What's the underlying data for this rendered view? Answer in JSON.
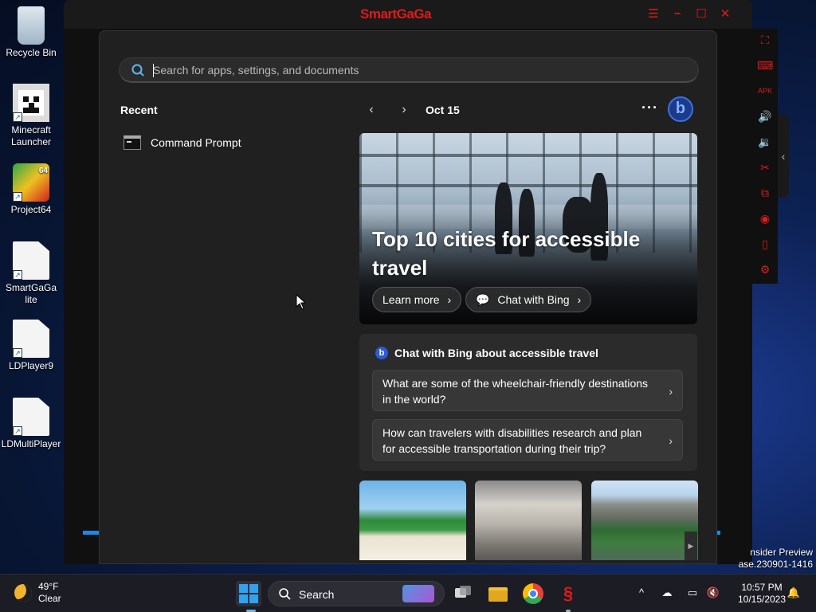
{
  "desktop": {
    "icons": [
      {
        "label": "Recycle Bin"
      },
      {
        "label": "Minecraft Launcher"
      },
      {
        "label": "Project64"
      },
      {
        "label": "SmartGaGa lite"
      },
      {
        "label": "LDPlayer9"
      },
      {
        "label": "LDMultiPlayer"
      }
    ],
    "project64_badge": "64",
    "insider_line1": "nsider Preview",
    "insider_line2": "ase.230901-1416"
  },
  "smartgaga": {
    "title": "SmartGaGa",
    "accent_color": "#e01a1a",
    "window_controls": {
      "menu": "☰",
      "minimize": "–",
      "maximize": "☐",
      "close": "✕"
    },
    "sidebar_icons": [
      "fullscreen-icon",
      "keyboard-icon",
      "apk-icon",
      "volume-up-icon",
      "volume-down-icon",
      "tools-icon",
      "multi-instance-icon",
      "location-icon",
      "shake-icon",
      "settings-icon"
    ],
    "sidebar_collapse": "‹"
  },
  "start_menu": {
    "search_placeholder": "Search for apps, settings, and documents",
    "recent": {
      "heading": "Recent",
      "items": [
        {
          "label": "Command Prompt"
        }
      ]
    },
    "feed": {
      "prev": "‹",
      "next": "›",
      "date": "Oct 15",
      "more": "···",
      "bing_logo": "b",
      "hero": {
        "title": "Top 10 cities for accessible travel",
        "learn_more": "Learn more",
        "chat_with_bing": "Chat with Bing",
        "chevron": "›"
      },
      "chat_card": {
        "heading": "Chat with Bing about accessible travel",
        "questions": [
          "What are some of the wheelchair-friendly destinations in the world?",
          "How can travelers with disabilities research and plan for accessible transportation during their trip?"
        ],
        "chevron": "›"
      },
      "thumb_scroll": "▶"
    }
  },
  "taskbar": {
    "weather": {
      "temp": "49°F",
      "condition": "Clear"
    },
    "search_label": "Search",
    "tray": {
      "time": "10:57 PM",
      "date": "10/15/2023",
      "expand": "^"
    }
  }
}
